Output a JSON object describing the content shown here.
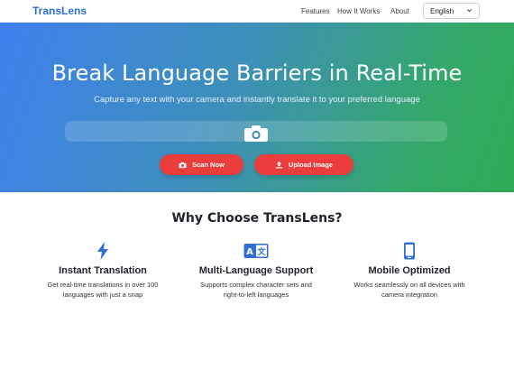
{
  "navbar": {
    "logo": "TransLens",
    "links": [
      "Features",
      "How It Works",
      "About"
    ],
    "language_selected": "English"
  },
  "hero": {
    "title": "Break Language Barriers in Real-Time",
    "subtitle": "Capture any text with your camera and instantly translate it to your preferred language",
    "scan_label": "Scan Now",
    "upload_label": "Upload Image"
  },
  "features_section": {
    "title": "Why Choose TransLens?",
    "items": [
      {
        "icon": "lightning-bolt-icon",
        "title": "Instant Translation",
        "desc": "Get real-time translations in over 100 languages with just a snap"
      },
      {
        "icon": "language-icon",
        "title": "Multi-Language Support",
        "desc": "Supports complex character sets and right-to-left languages"
      },
      {
        "icon": "mobile-phone-icon",
        "title": "Mobile Optimized",
        "desc": "Works seamlessly on all devices with camera integration"
      }
    ]
  },
  "colors": {
    "brand_blue": "#2f6fd6",
    "accent_red": "#ec3d3d",
    "gradient_start": "#3f80ee",
    "gradient_end": "#2faa55"
  }
}
